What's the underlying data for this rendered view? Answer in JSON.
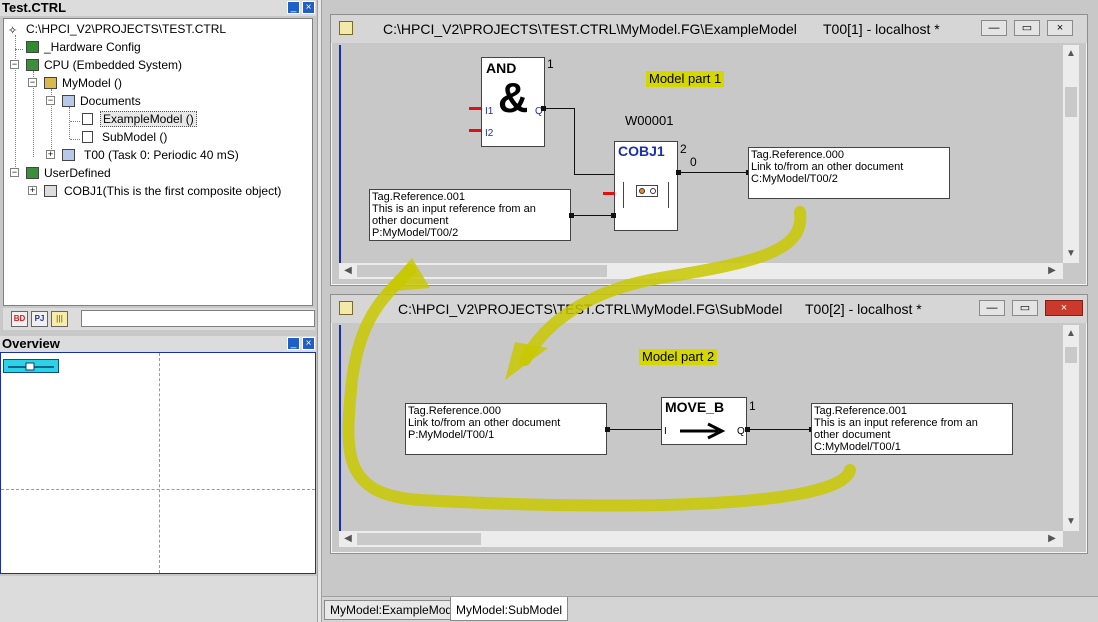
{
  "left_panel": {
    "title": "Test.CTRL",
    "tree": [
      {
        "label": "C:\\HPCI_V2\\PROJECTS\\TEST.CTRL",
        "icon": "project-root-icon"
      },
      {
        "label": "_Hardware Config",
        "icon": "hardware-icon"
      },
      {
        "label": "CPU (Embedded System)",
        "icon": "cpu-icon"
      },
      {
        "label": "MyModel ()",
        "icon": "model-icon"
      },
      {
        "label": "Documents",
        "icon": "folder-icon"
      },
      {
        "label": "ExampleModel ()",
        "icon": "document-icon"
      },
      {
        "label": "SubModel ()",
        "icon": "document-icon"
      },
      {
        "label": "T00  (Task 0: Periodic 40 mS)",
        "icon": "task-icon"
      },
      {
        "label": "UserDefined",
        "icon": "library-icon"
      },
      {
        "label": "COBJ1(This is the first composite object)",
        "icon": "composite-object-icon"
      }
    ],
    "toolbar": {
      "bd_label": "BD",
      "pj_label": "PJ",
      "lib_label": "lib",
      "field_value": ""
    }
  },
  "overview": {
    "title": "Overview"
  },
  "window1": {
    "title_path": "C:\\HPCI_V2\\PROJECTS\\TEST.CTRL\\MyModel.FG\\ExampleModel",
    "title_task": "T00[1] - localhost  *",
    "note": "Model part 1",
    "and_block": {
      "name": "AND",
      "symbol": "&",
      "index": "1",
      "in1": "I1",
      "in2": "I2",
      "out": "Q"
    },
    "cobj_block": {
      "name": "COBJ1",
      "index": "2",
      "out_value": "0"
    },
    "variable_label": "W00001",
    "ref_out": {
      "line1": "Tag.Reference.000",
      "line2": "Link to/from an other document",
      "line3": "C:MyModel/T00/2"
    },
    "ref_in": {
      "line1": "Tag.Reference.001",
      "line2": "This is an input reference from an",
      "line3": "other document",
      "line4": "P:MyModel/T00/2"
    }
  },
  "window2": {
    "title_path": "C:\\HPCI_V2\\PROJECTS\\TEST.CTRL\\MyModel.FG\\SubModel",
    "title_task": "T00[2] - localhost  *",
    "note": "Model part 2",
    "move_block": {
      "name": "MOVE_B",
      "index": "1",
      "in": "I",
      "out": "Q"
    },
    "ref_in": {
      "line1": "Tag.Reference.000",
      "line2": "Link to/from an other document",
      "line3": "P:MyModel/T00/1"
    },
    "ref_out": {
      "line1": "Tag.Reference.001",
      "line2": "This is an input reference from an",
      "line3": "other document",
      "line4": "C:MyModel/T00/1"
    }
  },
  "tabs": [
    {
      "label": "MyModel:ExampleModel",
      "active": false
    },
    {
      "label": "MyModel:SubModel",
      "active": true
    }
  ],
  "colors": {
    "accent": "#1a2fb0",
    "note_highlight": "#d6d600",
    "arrow": "#c8c800",
    "pin_red": "#e01010"
  }
}
